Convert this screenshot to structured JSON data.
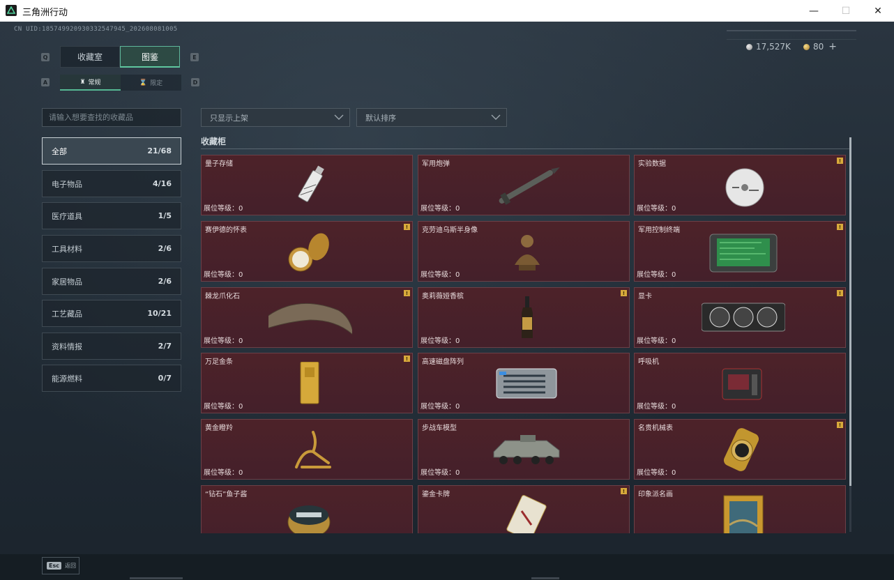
{
  "window": {
    "title": "三角洲行动",
    "minimize": "—",
    "maximize": "☐",
    "close": "✕"
  },
  "header": {
    "uid": "CN UID:185749920930332547945_202608081005",
    "currency": [
      {
        "icon": "silver-coin-icon",
        "value": "17,527K"
      },
      {
        "icon": "gold-coin-icon",
        "value": "80"
      }
    ],
    "add_label": "+"
  },
  "key_hints": {
    "prev_tab": "Q",
    "next_tab": "E",
    "prev_sub": "A",
    "next_sub": "D"
  },
  "tabs": [
    {
      "label": "收藏室",
      "active": false
    },
    {
      "label": "图鉴",
      "active": true
    }
  ],
  "subtabs": [
    {
      "label": "常规",
      "active": true
    },
    {
      "label": "限定",
      "active": false
    }
  ],
  "search": {
    "placeholder": "请输入想要查找的收藏品"
  },
  "filters": {
    "listing": "只显示上架",
    "sort": "默认排序"
  },
  "categories": [
    {
      "label": "全部",
      "count": "21/68",
      "active": true
    },
    {
      "label": "电子物品",
      "count": "4/16"
    },
    {
      "label": "医疗道具",
      "count": "1/5"
    },
    {
      "label": "工具材料",
      "count": "2/6"
    },
    {
      "label": "家居物品",
      "count": "2/6"
    },
    {
      "label": "工艺藏品",
      "count": "10/21"
    },
    {
      "label": "资料情报",
      "count": "2/7"
    },
    {
      "label": "能源燃料",
      "count": "0/7"
    }
  ],
  "cabinet": {
    "title": "收藏柜",
    "level_prefix": "展位等级：",
    "items": [
      {
        "name": "量子存储",
        "level": "0",
        "badge": false
      },
      {
        "name": "军用炮弹",
        "level": "0",
        "badge": false
      },
      {
        "name": "实验数据",
        "level": "0",
        "badge": true
      },
      {
        "name": "赛伊德的怀表",
        "level": "0",
        "badge": true
      },
      {
        "name": "克劳迪乌斯半身像",
        "level": "0",
        "badge": false
      },
      {
        "name": "军用控制终端",
        "level": "0",
        "badge": true
      },
      {
        "name": "棘龙爪化石",
        "level": "0",
        "badge": true
      },
      {
        "name": "奥莉薇娅香槟",
        "level": "0",
        "badge": true
      },
      {
        "name": "显卡",
        "level": "0",
        "badge": true
      },
      {
        "name": "万足金条",
        "level": "0",
        "badge": true
      },
      {
        "name": "高速磁盘阵列",
        "level": "0",
        "badge": false
      },
      {
        "name": "呼吸机",
        "level": "0",
        "badge": false
      },
      {
        "name": "黄金瞪羚",
        "level": "0",
        "badge": false
      },
      {
        "name": "步战车模型",
        "level": "0",
        "badge": false
      },
      {
        "name": "名贵机械表",
        "level": "0",
        "badge": true
      },
      {
        "name": "“钻石”鱼子酱",
        "level": "",
        "badge": false
      },
      {
        "name": "鎏金卡牌",
        "level": "",
        "badge": true
      },
      {
        "name": "印象派名画",
        "level": "",
        "badge": false
      }
    ],
    "badge_text": "!"
  },
  "footer": {
    "esc_key": "Esc",
    "back_label": "返回"
  },
  "colors": {
    "accent_green": "#5fc79f",
    "card_bg": "#4d2229",
    "badge": "#d7a93b"
  }
}
